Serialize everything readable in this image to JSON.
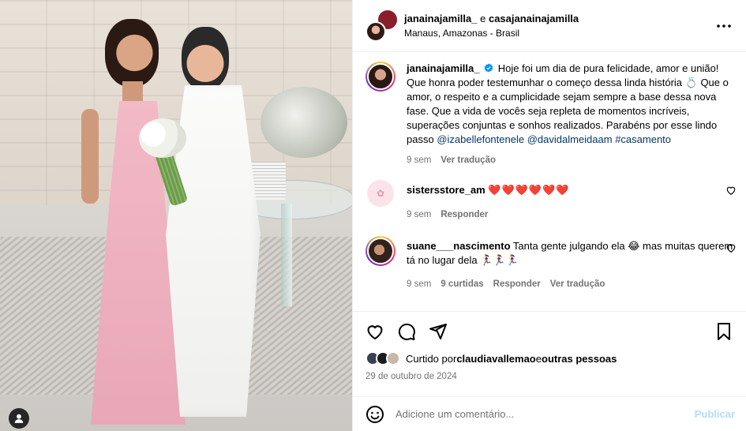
{
  "header": {
    "author": "janainajamilla_",
    "connector": " e ",
    "collaborator": "casajanainajamilla",
    "location": "Manaus, Amazonas - Brasil"
  },
  "caption": {
    "username": "janainajamilla_",
    "text_main": "Hoje foi um dia de pura felicidade, amor e união! Que honra poder testemunhar o começo dessa linda história 💍 Que o amor, o respeito e a cumplicidade sejam sempre a base dessa nova fase. Que a vida de vocês seja repleta de momentos incríveis, superações conjuntas e sonhos realizados. Parabéns por esse lindo passo ",
    "mention_1": "@izabellefontenele",
    "mention_2": "@davidalmeidaam",
    "hashtag": "#casamento",
    "time": "9 sem",
    "translate": "Ver tradução"
  },
  "comments": [
    {
      "username": "sistersstore_am",
      "text": "❤️❤️❤️❤️❤️❤️",
      "time": "9 sem",
      "reply": "Responder"
    },
    {
      "username": "suane___nascimento",
      "text": "Tanta gente julgando ela 😂 mas muitas querem tá no lugar dela 🏃‍♀️🏃‍♀️🏃‍♀️",
      "time": "9 sem",
      "likes": "9 curtidas",
      "reply": "Responder",
      "translate": "Ver tradução"
    }
  ],
  "likes": {
    "prefix": "Curtido por ",
    "user": "claudiavallemao",
    "suffix": " e ",
    "others": "outras pessoas"
  },
  "date": "29 de outubro de 2024",
  "add_comment": {
    "placeholder": "Adicione um comentário...",
    "publish": "Publicar"
  },
  "colors": {
    "link": "#00376b",
    "muted": "#737373",
    "publish_disabled": "#b3dbff",
    "heart_red": "#ed4956"
  },
  "icons": [
    "user-tag-icon",
    "more-options-icon",
    "verified-badge-icon",
    "heart-icon",
    "comment-icon",
    "share-icon",
    "bookmark-icon",
    "emoji-icon"
  ]
}
